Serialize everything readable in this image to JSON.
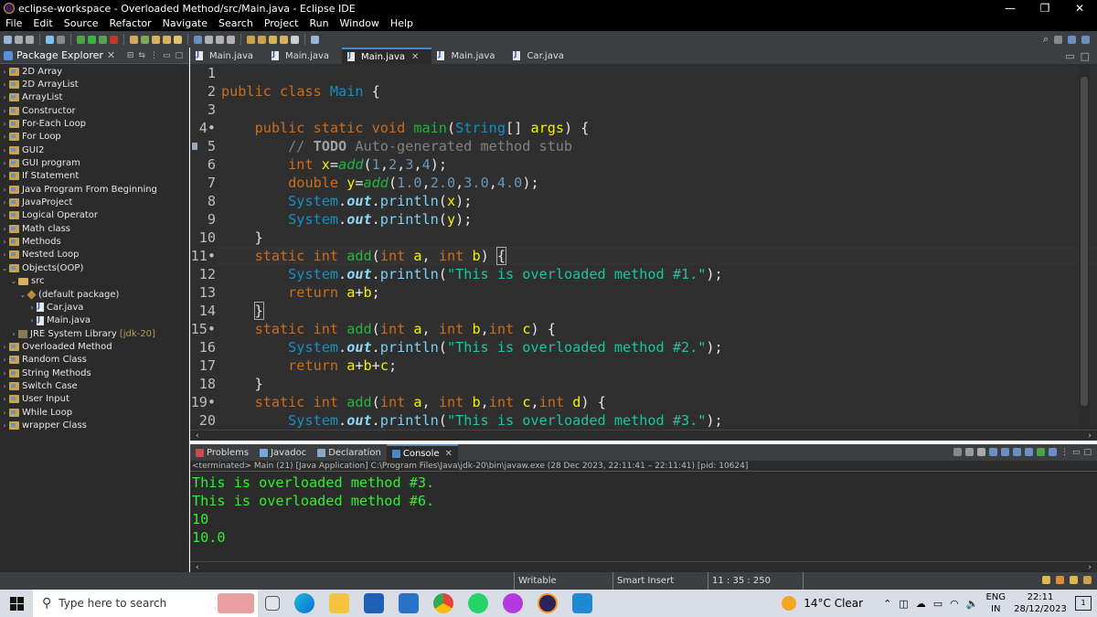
{
  "window": {
    "title": "eclipse-workspace - Overloaded Method/src/Main.java - Eclipse IDE",
    "minimize": "—",
    "maximize": "❐",
    "close": "✕"
  },
  "menu": [
    "File",
    "Edit",
    "Source",
    "Refactor",
    "Navigate",
    "Search",
    "Project",
    "Run",
    "Window",
    "Help"
  ],
  "explorer": {
    "title": "Package Explorer",
    "items": [
      {
        "label": "2D Array",
        "arrow": "›"
      },
      {
        "label": "2D ArrayList",
        "arrow": "›"
      },
      {
        "label": "ArrayList",
        "arrow": "›"
      },
      {
        "label": "Constructor",
        "arrow": "›"
      },
      {
        "label": "For-Each Loop",
        "arrow": "›"
      },
      {
        "label": "For Loop",
        "arrow": "›"
      },
      {
        "label": "GUI2",
        "arrow": "›"
      },
      {
        "label": "GUI program",
        "arrow": "›"
      },
      {
        "label": "If Statement",
        "arrow": "›"
      },
      {
        "label": "Java Program From Beginning",
        "arrow": "›"
      },
      {
        "label": "JavaProject",
        "arrow": "›"
      },
      {
        "label": "Logical Operator",
        "arrow": "›"
      },
      {
        "label": "Math class",
        "arrow": "›"
      },
      {
        "label": "Methods",
        "arrow": "›"
      },
      {
        "label": "Nested Loop",
        "arrow": "›"
      },
      {
        "label": "Objects(OOP)",
        "arrow": "⌄"
      },
      {
        "label": "src",
        "arrow": "⌄"
      },
      {
        "label": "(default package)",
        "arrow": "⌄"
      },
      {
        "label": "Car.java",
        "arrow": "›"
      },
      {
        "label": "Main.java",
        "arrow": "›"
      },
      {
        "label": "JRE System Library",
        "arrow": "›",
        "suffix": "[jdk-20]"
      },
      {
        "label": "Overloaded Method",
        "arrow": "›"
      },
      {
        "label": "Random Class",
        "arrow": "›"
      },
      {
        "label": "String Methods",
        "arrow": "›"
      },
      {
        "label": "Switch Case",
        "arrow": "›"
      },
      {
        "label": "User Input",
        "arrow": "›"
      },
      {
        "label": "While Loop",
        "arrow": "›"
      },
      {
        "label": "wrapper Class",
        "arrow": "›"
      }
    ]
  },
  "editor_tabs": [
    {
      "label": "Main.java"
    },
    {
      "label": "Main.java"
    },
    {
      "label": "Main.java",
      "active": true
    },
    {
      "label": "Main.java"
    },
    {
      "label": "Car.java"
    }
  ],
  "code": {
    "line_numbers": [
      "1",
      "2",
      "3",
      "4•",
      "5",
      "6",
      "7",
      "8",
      "9",
      "10",
      "11•",
      "12",
      "13",
      "14",
      "15•",
      "16",
      "17",
      "18",
      "19•",
      "20"
    ]
  },
  "bottom_tabs": [
    {
      "label": "Problems",
      "color": "#c94c4c"
    },
    {
      "label": "Javadoc",
      "color": "#7aa7d6"
    },
    {
      "label": "Declaration",
      "color": "#8aa6c8"
    },
    {
      "label": "Console",
      "color": "#4a88c7",
      "active": true
    }
  ],
  "console": {
    "header": "<terminated> Main (21) [Java Application] C:\\Program Files\\Java\\jdk-20\\bin\\javaw.exe  (28 Dec 2023, 22:11:41 – 22:11:41) [pid: 10624]",
    "lines": [
      "This is overloaded method #3.",
      "This is overloaded method #6.",
      "10",
      "10.0"
    ]
  },
  "status": {
    "writable": "Writable",
    "insert_mode": "Smart Insert",
    "position": "11 : 35 : 250"
  },
  "taskbar": {
    "search_placeholder": "Type here to search",
    "weather": "14°C  Clear",
    "lang_top": "ENG",
    "lang_bottom": "IN",
    "time": "22:11",
    "date": "28/12/2023",
    "notif_count": "1"
  }
}
